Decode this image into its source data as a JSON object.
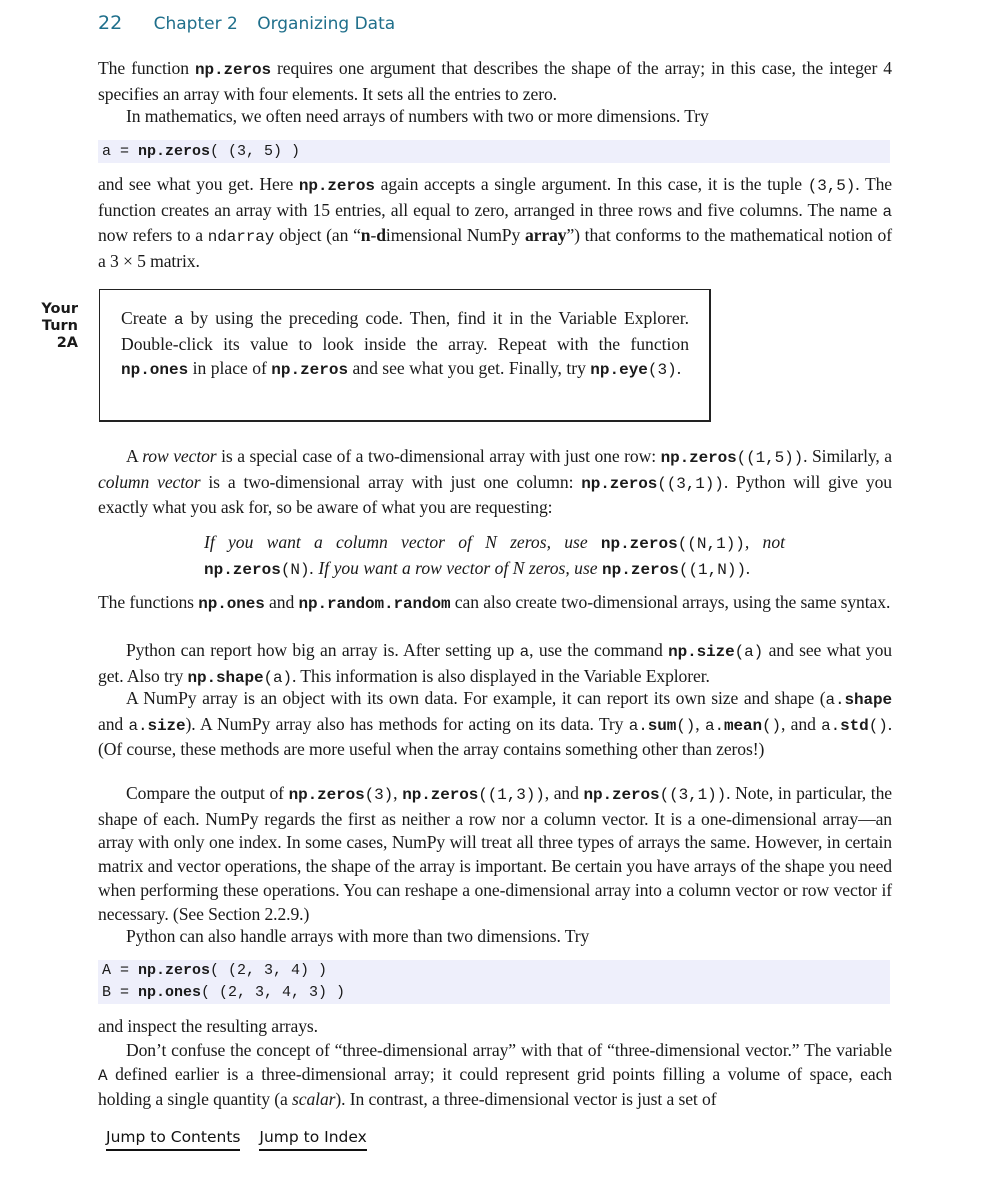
{
  "header": {
    "page_number": "22",
    "chapter": "Chapter 2",
    "chapter_title": "Organizing Data",
    "accent_color": "#1f6f8b"
  },
  "para1": {
    "t1": "The function ",
    "c1": "np.zeros",
    "t2": " requires one argument that describes the shape of the array; in this case, the integer 4 specifies an array with four elements. It sets all the entries to zero."
  },
  "para2": {
    "t1": "In mathematics, we often need arrays of numbers with two or more dimensions. Try"
  },
  "code1": {
    "lines": [
      "a = np.zeros( (3, 5) )"
    ]
  },
  "para3": {
    "t1": "and see what you get. Here ",
    "c1": "np.zeros",
    "t2": " again accepts a single argument. In this case, it is the tuple ",
    "c2": "(3,5)",
    "t3": ". The function creates an array with 15 entries, all equal to zero, arranged in three rows and five columns. The name ",
    "c3": "a",
    "t4": " now refers to a ",
    "c4": "ndarray",
    "t5": " object (an “",
    "b1": "n",
    "t6": "-",
    "b2": "d",
    "t7": "imensional NumPy ",
    "b3": "array",
    "t8": "”) that conforms to the mathematical notion of a 3 × 5 matrix."
  },
  "your_turn": {
    "label_line1": "Your",
    "label_line2": "Turn",
    "label_line3": "2A",
    "t1": "Create ",
    "c1": "a",
    "t2": " by using the preceding code. Then, find it in the Variable Explorer. Double-click its value to look inside the array. Repeat with the function ",
    "c2": "np.ones",
    "t3": " in place of ",
    "c3": "np.zeros",
    "t4": " and see what you get. Finally, try ",
    "c4": "np.eye",
    "c5": "(3)",
    "t5": "."
  },
  "para4": {
    "t1": "A ",
    "i1": "row vector",
    "t2": " is a special case of a two-dimensional array with just one row: ",
    "c1": "np.zeros",
    "c1b": "((1,5))",
    "t3": ". Similarly, a ",
    "i2": "column vector",
    "t4": " is a two-dimensional array with just one column: ",
    "c2": "np.zeros",
    "c2b": "((3,1))",
    "t5": ". Python will give you exactly what you ask for, so be aware of what you are requesting:"
  },
  "quote": {
    "t1": "If you want a column vector of N zeros, use ",
    "c1": "np.zeros",
    "c1b": "((N,1))",
    "t2": ", not ",
    "c2": "np.zeros",
    "c2b": "(N)",
    "t3": ". If you want a row vector of N zeros, use ",
    "c3": "np.zeros",
    "c3b": "((1,N))",
    "t4": "."
  },
  "para5": {
    "t1": "The functions ",
    "c1": "np.ones",
    "t2": " and ",
    "c2": "np.random.random",
    "t3": " can also create two-dimensional arrays, using the same syntax."
  },
  "para6": {
    "t1": "Python can report how big an array is. After setting up ",
    "c1": "a",
    "t2": ", use the command ",
    "c2": "np.size",
    "c2b": "(a)",
    "t3": " and see what you get. Also try ",
    "c3": "np.shape",
    "c3b": "(a)",
    "t4": ". This information is also displayed in the Variable Explorer."
  },
  "para7": {
    "t1": "A NumPy array is an object with its own data. For example, it can report its own size and shape (",
    "c1a": "a.",
    "c1": "shape",
    "t2": " and ",
    "c2a": "a.",
    "c2": "size",
    "t3": "). A NumPy array also has methods for acting on its data. Try ",
    "c3a": "a.",
    "c3": "sum",
    "c3b": "()",
    "t4": ", ",
    "c4a": "a.",
    "c4": "mean",
    "c4b": "()",
    "t5": ", and ",
    "c5a": "a.",
    "c5": "std",
    "c5b": "()",
    "t6": ". (Of course, these methods are more useful when the array contains something other than zeros!)"
  },
  "para8": {
    "t1": "Compare the output of ",
    "c1": "np.zeros",
    "c1b": "(3)",
    "t2": ", ",
    "c2": "np.zeros",
    "c2b": "((1,3))",
    "t3": ", and ",
    "c3": "np.zeros",
    "c3b": "((3,1))",
    "t4": ". Note, in particular, the shape of each. NumPy regards the first as neither a row nor a column vector. It is a one-dimensional array—an array with only one index. In some cases, NumPy will treat all three types of arrays the same. However, in certain matrix and vector operations, the shape of the array is important. Be certain you have arrays of the shape you need when performing these operations. You can reshape a one-dimensional array into a column vector or row vector if necessary. (See Section 2.2.9.)"
  },
  "para9": {
    "t1": "Python can also handle arrays with more than two dimensions. Try"
  },
  "code2": {
    "line1_a": "A = ",
    "line1_b": "np.zeros",
    "line1_c": "( (2, 3, 4) )",
    "line2_a": "B = ",
    "line2_b": "np.ones",
    "line2_c": "( (2, 3, 4, 3) )"
  },
  "para10": {
    "t1": "and inspect the resulting arrays."
  },
  "para11": {
    "t1": "Don’t confuse the concept of “three-dimensional array” with that of “three-dimensional vector.” The variable ",
    "c1": "A",
    "t2": " defined earlier is a three-dimensional array; it could represent grid points filling a volume of space, each holding a single quantity (a ",
    "i1": "scalar",
    "t3": "). In contrast, a three-dimensional vector is just a set of"
  },
  "footer": {
    "contents_link": "Jump to Contents",
    "index_link": "Jump to Index"
  }
}
